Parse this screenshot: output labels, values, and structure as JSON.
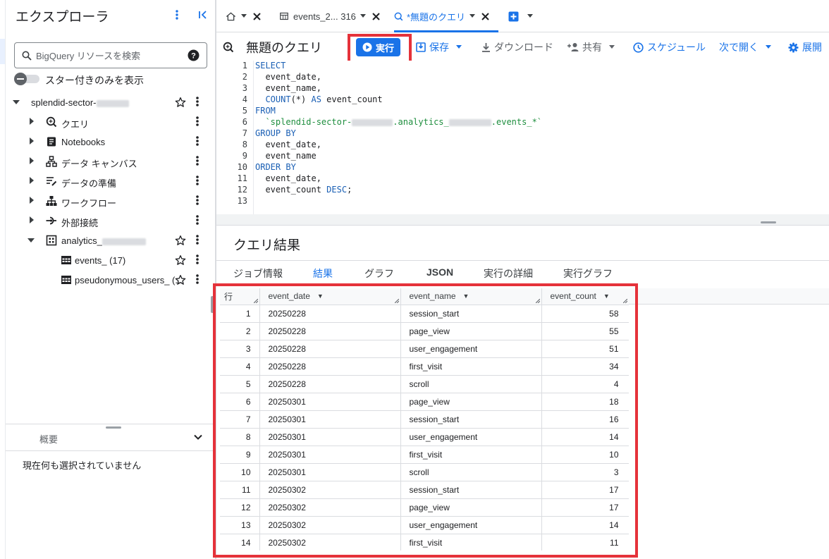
{
  "explorer": {
    "title": "エクスプローラ",
    "search_placeholder": "BigQuery リソースを検索",
    "starred_only_label": "スター付きのみを表示",
    "project": {
      "label": "splendid-sector-"
    },
    "children": [
      {
        "label": "クエリ",
        "icon": "query-icon"
      },
      {
        "label": "Notebooks",
        "icon": "notebook-icon"
      },
      {
        "label": "データ キャンバス",
        "icon": "canvas-icon"
      },
      {
        "label": "データの準備",
        "icon": "data-prep-icon"
      },
      {
        "label": "ワークフロー",
        "icon": "workflow-icon"
      },
      {
        "label": "外部接続",
        "icon": "connection-icon"
      }
    ],
    "dataset": {
      "label": "analytics_"
    },
    "tables": [
      {
        "label": "events_ (17)"
      },
      {
        "label": "pseudonymous_users_ (..."
      }
    ]
  },
  "details": {
    "title": "概要",
    "empty_text": "現在何も選択されていません"
  },
  "tabs": [
    {
      "label": "events_2... 316"
    },
    {
      "label": "*無題のクエリ"
    }
  ],
  "toolbar": {
    "query_title": "無題のクエリ",
    "run_label": "実行",
    "save_label": "保存",
    "download_label": "ダウンロード",
    "share_label": "共有",
    "schedule_label": "スケジュール",
    "open_in_label": "次で開く",
    "expand_label": "展開"
  },
  "editor": {
    "line_numbers": [
      "1",
      "2",
      "3",
      "4",
      "5",
      "6",
      "7",
      "8",
      "9",
      "10",
      "11",
      "12",
      "13"
    ],
    "lines": [
      {
        "kw": "SELECT",
        "rest": ""
      },
      {
        "kw": "",
        "rest": "  event_date,"
      },
      {
        "kw": "",
        "rest": "  event_name,"
      },
      {
        "kw": "",
        "rest": "  COUNT(*) AS event_count"
      },
      {
        "kw": "FROM",
        "rest": ""
      },
      {
        "kw": "",
        "rest": "  `splendid-sector-",
        "rest2": ".analytics_",
        "rest3": ".events_*`"
      },
      {
        "kw": "GROUP BY",
        "rest": ""
      },
      {
        "kw": "",
        "rest": "  event_date,"
      },
      {
        "kw": "",
        "rest": "  event_name"
      },
      {
        "kw": "ORDER BY",
        "rest": ""
      },
      {
        "kw": "",
        "rest": "  event_date,"
      },
      {
        "kw": "",
        "rest": "  event_count DESC;"
      },
      {
        "kw": "",
        "rest": ""
      }
    ]
  },
  "results": {
    "title": "クエリ結果",
    "tabs": [
      "ジョブ情報",
      "結果",
      "グラフ",
      "JSON",
      "実行の詳細",
      "実行グラフ"
    ],
    "columns": [
      "行",
      "event_date",
      "event_name",
      "event_count"
    ],
    "rows": [
      [
        "1",
        "20250228",
        "session_start",
        "58"
      ],
      [
        "2",
        "20250228",
        "page_view",
        "55"
      ],
      [
        "3",
        "20250228",
        "user_engagement",
        "51"
      ],
      [
        "4",
        "20250228",
        "first_visit",
        "34"
      ],
      [
        "5",
        "20250228",
        "scroll",
        "4"
      ],
      [
        "6",
        "20250301",
        "page_view",
        "18"
      ],
      [
        "7",
        "20250301",
        "session_start",
        "16"
      ],
      [
        "8",
        "20250301",
        "user_engagement",
        "14"
      ],
      [
        "9",
        "20250301",
        "first_visit",
        "10"
      ],
      [
        "10",
        "20250301",
        "scroll",
        "3"
      ],
      [
        "11",
        "20250302",
        "session_start",
        "17"
      ],
      [
        "12",
        "20250302",
        "page_view",
        "17"
      ],
      [
        "13",
        "20250302",
        "user_engagement",
        "14"
      ],
      [
        "14",
        "20250302",
        "first_visit",
        "11"
      ]
    ]
  },
  "colors": {
    "accent": "#1a73e8",
    "highlight": "#e5323a"
  }
}
